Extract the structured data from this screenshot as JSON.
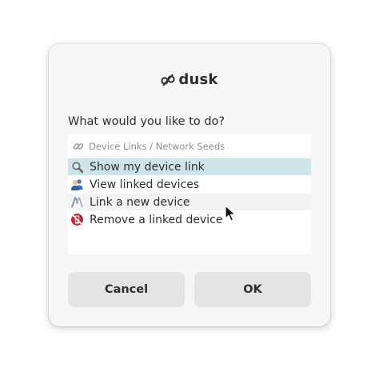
{
  "dialog": {
    "brand_name": "dusk",
    "question": "What would you like to do?",
    "list_header": "Device Links / Network Seeds",
    "options": [
      {
        "label": "Show my device link",
        "icon": "magnifier-icon",
        "selected": true
      },
      {
        "label": "View linked devices",
        "icon": "users-icon",
        "selected": false
      },
      {
        "label": "Link a new device",
        "icon": "handshake-icon",
        "selected": false
      },
      {
        "label": "Remove a linked device",
        "icon": "no-mobile-icon",
        "selected": false
      }
    ],
    "cancel_label": "Cancel",
    "ok_label": "OK"
  },
  "colors": {
    "selection": "#cde5ea",
    "dialog_bg": "#f6f6f6",
    "button_bg": "#e4e4e4",
    "text": "#2e2e2e"
  }
}
